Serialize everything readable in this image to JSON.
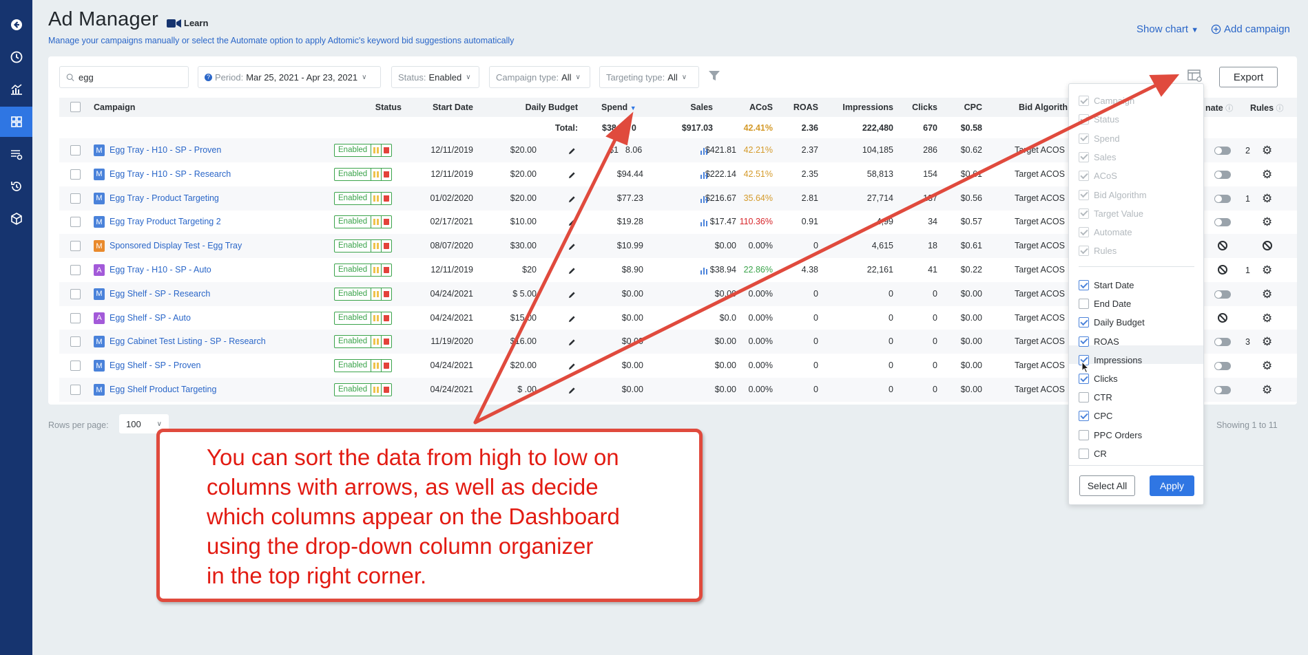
{
  "sidebar": {
    "items": [
      "back-icon",
      "clock-icon",
      "analytics-icon",
      "dashboard-icon",
      "list-settings-icon",
      "history-icon",
      "box-icon"
    ],
    "active_index": 3
  },
  "header": {
    "title": "Ad Manager",
    "learn_label": "Learn",
    "subtitle": "Manage your campaigns manually or select the Automate option to apply Adtomic's keyword bid suggestions automatically",
    "show_chart_label": "Show chart",
    "add_campaign_label": "Add campaign"
  },
  "filters": {
    "search_value": "egg",
    "period_label": "Period:",
    "period_value": "Mar 25, 2021 - Apr 23, 2021",
    "status_label": "Status:",
    "status_value": "Enabled",
    "campaign_type_label": "Campaign type:",
    "campaign_type_value": "All",
    "targeting_type_label": "Targeting type:",
    "targeting_type_value": "All",
    "export_label": "Export"
  },
  "table": {
    "columns": {
      "campaign": "Campaign",
      "status": "Status",
      "start_date": "Start Date",
      "daily_budget": "Daily Budget",
      "spend": "Spend",
      "sales": "Sales",
      "acos": "ACoS",
      "roas": "ROAS",
      "impressions": "Impressions",
      "clicks": "Clicks",
      "cpc": "CPC",
      "bid_algorithm": "Bid Algorith",
      "automate": "nate",
      "rules": "Rules"
    },
    "totals": {
      "label": "Total:",
      "spend": "$38",
      "spend_tail": "0",
      "sales": "$917.03",
      "acos": "42.41%",
      "roas": "2.36",
      "impressions": "222,480",
      "clicks": "670",
      "cpc": "$0.58"
    },
    "status_value": "Enabled",
    "rows": [
      {
        "type": "M",
        "type_color": "#4a82da",
        "name": "Egg Tray - H10 - SP - Proven",
        "start": "12/11/2019",
        "budget": "$20.00",
        "spend": "$1",
        "spend_tail": "8.06",
        "sales": "$421.81",
        "acos": "42.21%",
        "acos_color": "#d49a2a",
        "roas": "2.37",
        "impr": "104,185",
        "clicks": "286",
        "cpc": "$0.62",
        "bid": "Target ACOS",
        "automate": "toggle",
        "rules_count": "2"
      },
      {
        "type": "M",
        "type_color": "#4a82da",
        "name": "Egg Tray - H10 - SP - Research",
        "start": "12/11/2019",
        "budget": "$20.00",
        "spend": "$94.44",
        "spend_tail": "",
        "sales": "$222.14",
        "acos": "42.51%",
        "acos_color": "#d49a2a",
        "roas": "2.35",
        "impr": "58,813",
        "clicks": "154",
        "cpc": "$0.61",
        "bid": "Target ACOS",
        "automate": "toggle",
        "rules_count": ""
      },
      {
        "type": "M",
        "type_color": "#4a82da",
        "name": "Egg Tray - Product Targeting",
        "start": "01/02/2020",
        "budget": "$20.00",
        "spend": "$77.23",
        "spend_tail": "",
        "sales": "$216.67",
        "acos": "35.64%",
        "acos_color": "#d49a2a",
        "roas": "2.81",
        "impr": "27,714",
        "clicks": "137",
        "cpc": "$0.56",
        "bid": "Target ACOS",
        "automate": "toggle",
        "rules_count": "1"
      },
      {
        "type": "M",
        "type_color": "#4a82da",
        "name": "Egg Tray Product Targeting 2",
        "start": "02/17/2021",
        "budget": "$10.00",
        "spend": "$19.28",
        "spend_tail": "",
        "sales": "$17.47",
        "acos": "110.36%",
        "acos_color": "#d7262b",
        "roas": "0.91",
        "impr": "4,99",
        "clicks": "34",
        "cpc": "$0.57",
        "bid": "Target ACOS",
        "automate": "toggle",
        "rules_count": ""
      },
      {
        "type": "M",
        "type_color": "#e98a2c",
        "name": "Sponsored Display Test - Egg Tray",
        "start": "08/07/2020",
        "budget": "$30.00",
        "spend": "$10.99",
        "spend_tail": "",
        "sales": "$0.00",
        "acos": "0.00%",
        "acos_color": "#2b2f33",
        "roas": "0",
        "impr": "4,615",
        "clicks": "18",
        "cpc": "$0.61",
        "bid": "Target ACOS",
        "automate": "forbid",
        "rules_count": "",
        "rules_forbid": true
      },
      {
        "type": "A",
        "type_color": "#a35ad9",
        "name": "Egg Tray - H10 - SP - Auto",
        "start": "12/11/2019",
        "budget": "$20",
        "spend": "$8.90",
        "spend_tail": "",
        "sales": "$38.94",
        "acos": "22.86%",
        "acos_color": "#3aa34a",
        "roas": "4.38",
        "impr": "22,161",
        "clicks": "41",
        "cpc": "$0.22",
        "bid": "Target ACOS",
        "automate": "forbid",
        "rules_count": "1"
      },
      {
        "type": "M",
        "type_color": "#4a82da",
        "name": "Egg Shelf - SP - Research",
        "start": "04/24/2021",
        "budget": "$ 5.00",
        "spend": "$0.00",
        "spend_tail": "",
        "sales": "$0.00",
        "acos": "0.00%",
        "acos_color": "#2b2f33",
        "roas": "0",
        "impr": "0",
        "clicks": "0",
        "cpc": "$0.00",
        "bid": "Target ACOS",
        "automate": "toggle",
        "rules_count": ""
      },
      {
        "type": "A",
        "type_color": "#a35ad9",
        "name": "Egg Shelf - SP - Auto",
        "start": "04/24/2021",
        "budget": "$15.00",
        "spend": "$0.00",
        "spend_tail": "",
        "sales": "$0.0",
        "acos": "0.00%",
        "acos_color": "#2b2f33",
        "roas": "0",
        "impr": "0",
        "clicks": "0",
        "cpc": "$0.00",
        "bid": "Target ACOS",
        "automate": "forbid",
        "rules_count": ""
      },
      {
        "type": "M",
        "type_color": "#4a82da",
        "name": "Egg Cabinet Test Listing - SP - Research",
        "start": "11/19/2020",
        "budget": "$16.00",
        "spend": "$0.00",
        "spend_tail": "",
        "sales": "$0.00",
        "acos": "0.00%",
        "acos_color": "#2b2f33",
        "roas": "0",
        "impr": "0",
        "clicks": "0",
        "cpc": "$0.00",
        "bid": "Target ACOS",
        "automate": "toggle",
        "rules_count": "3"
      },
      {
        "type": "M",
        "type_color": "#4a82da",
        "name": "Egg Shelf - SP - Proven",
        "start": "04/24/2021",
        "budget": "$20.00",
        "spend": "$0.00",
        "spend_tail": "",
        "sales": "$0.00",
        "acos": "0.00%",
        "acos_color": "#2b2f33",
        "roas": "0",
        "impr": "0",
        "clicks": "0",
        "cpc": "$0.00",
        "bid": "Target ACOS",
        "automate": "toggle",
        "rules_count": ""
      },
      {
        "type": "M",
        "type_color": "#4a82da",
        "name": "Egg Shelf Product Targeting",
        "start": "04/24/2021",
        "budget": "$ .00",
        "spend": "$0.00",
        "spend_tail": "",
        "sales": "$0.00",
        "acos": "0.00%",
        "acos_color": "#2b2f33",
        "roas": "0",
        "impr": "0",
        "clicks": "0",
        "cpc": "$0.00",
        "bid": "Target ACOS",
        "automate": "toggle",
        "rules_count": ""
      }
    ]
  },
  "pagination": {
    "rows_per_page_label": "Rows per page:",
    "rows_per_page_value": "100",
    "showing": "Showing 1 to 11"
  },
  "column_organizer": {
    "locked": [
      "Campaign",
      "Status",
      "Spend",
      "Sales",
      "ACoS",
      "Bid Algorithm",
      "Target Value",
      "Automate",
      "Rules"
    ],
    "optional": [
      {
        "label": "Start Date",
        "checked": true
      },
      {
        "label": "End Date",
        "checked": false
      },
      {
        "label": "Daily Budget",
        "checked": true
      },
      {
        "label": "ROAS",
        "checked": true
      },
      {
        "label": "Impressions",
        "checked": true
      },
      {
        "label": "Clicks",
        "checked": true
      },
      {
        "label": "CTR",
        "checked": false
      },
      {
        "label": "CPC",
        "checked": true
      },
      {
        "label": "PPC Orders",
        "checked": false
      },
      {
        "label": "CR",
        "checked": false
      }
    ],
    "select_all_label": "Select All",
    "apply_label": "Apply"
  },
  "callout": {
    "lines": [
      "You can sort the data from high to low on",
      "columns with arrows, as well as decide",
      "which columns appear on the Dashboard",
      "using the drop-down column organizer",
      "in the top right corner."
    ]
  },
  "colors": {
    "sidebar": "#16346f",
    "sidebar_active": "#2f76e3",
    "link": "#2a66c8",
    "enabled": "#3aa34a",
    "annotation": "#e04a3d"
  }
}
